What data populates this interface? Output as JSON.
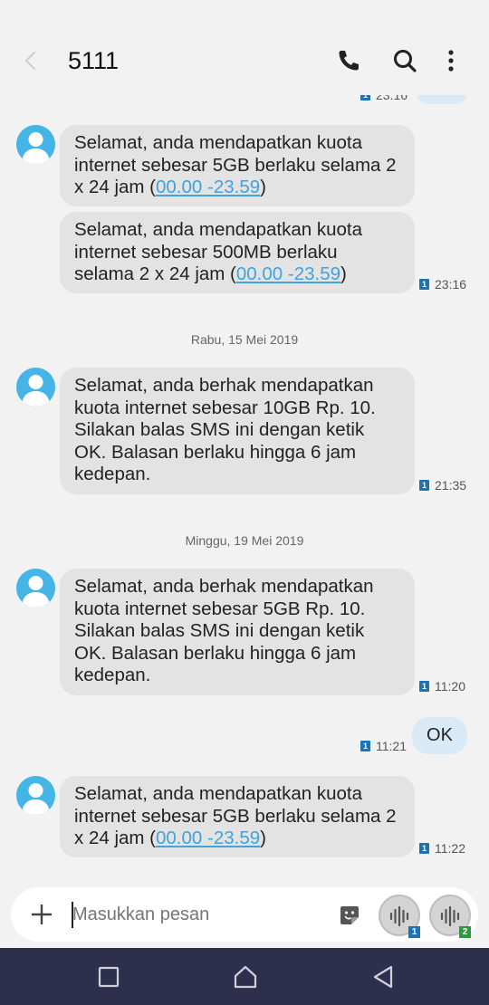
{
  "header": {
    "title": "5111",
    "icons": [
      "back-icon",
      "phone-icon",
      "search-icon",
      "more-icon"
    ]
  },
  "thread": {
    "partial_prev_time": "23.16",
    "messages": [
      {
        "parts": [
          "Selamat, anda mendapatkan kuota internet sebesar 5GB berlaku selama 2 x 24 jam (",
          "00.00 -23.59",
          ")"
        ]
      },
      {
        "parts": [
          "Selamat, anda mendapatkan kuota internet sebesar 500MB berlaku selama 2 x 24 jam (",
          "00.00 -23.59",
          ")"
        ],
        "sim": "1",
        "time": "23:16"
      },
      {
        "date": "Rabu, 15 Mei 2019",
        "text": "Selamat, anda berhak mendapatkan kuota internet sebesar 10GB Rp. 10. Silakan balas SMS ini dengan ketik OK. Balasan berlaku hingga 6 jam kedepan.",
        "sim": "1",
        "time": "21:35"
      },
      {
        "date": "Minggu, 19 Mei 2019",
        "text": "Selamat, anda berhak mendapatkan kuota internet sebesar 5GB Rp. 10. Silakan balas SMS ini dengan ketik OK. Balasan berlaku hingga 6 jam kedepan.",
        "sim": "1",
        "time": "11:20"
      },
      {
        "outgoing": true,
        "text": "OK",
        "sim": "1",
        "time": "11:21"
      },
      {
        "parts": [
          "Selamat, anda mendapatkan kuota internet sebesar 5GB berlaku selama 2 x 24 jam (",
          "00.00 -23.59",
          ")"
        ],
        "sim": "1",
        "time": "11:22"
      }
    ]
  },
  "composer": {
    "placeholder": "Masukkan pesan",
    "voice_sim_1": "1",
    "voice_sim_2": "2"
  },
  "colors": {
    "avatar": "#45b4e6",
    "incoming_bubble": "#e3e3e3",
    "outgoing_bubble": "#d9eaf6",
    "link": "#3fa3dc",
    "sim1": "#1a73b5",
    "sim2": "#2c9a3f",
    "navbar": "#2e2f4d"
  }
}
